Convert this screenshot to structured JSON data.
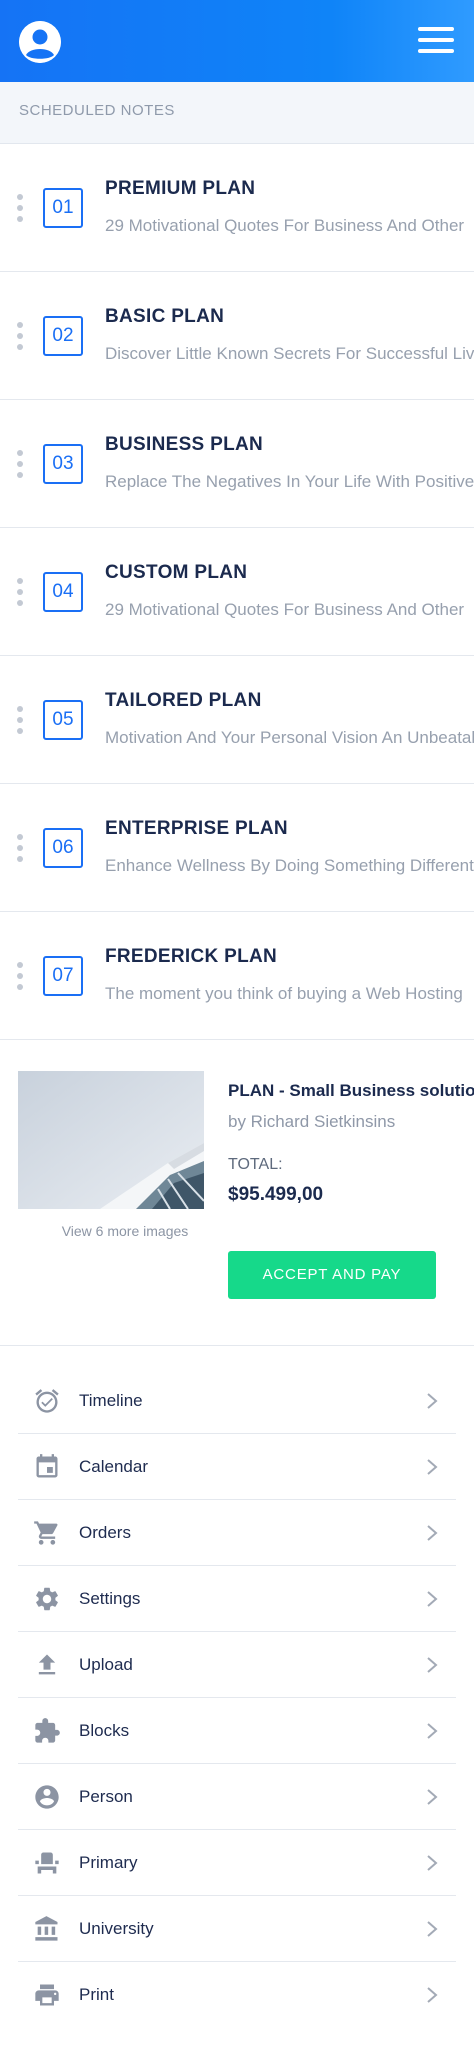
{
  "header": {
    "avatar_icon": "account-circle-icon",
    "menu_icon": "hamburger-menu-icon",
    "colors": {
      "gradient_start": "#1573f5",
      "gradient_end": "#2f9bff"
    }
  },
  "section": {
    "title": "SCHEDULED NOTES"
  },
  "plans": [
    {
      "number": "01",
      "title": "PREMIUM PLAN",
      "description": "29 Motivational Quotes For Business And Other"
    },
    {
      "number": "02",
      "title": "BASIC PLAN",
      "description": "Discover Little Known Secrets For Successful Living"
    },
    {
      "number": "03",
      "title": "BUSINESS PLAN",
      "description": "Replace The Negatives In Your Life With Positives"
    },
    {
      "number": "04",
      "title": "CUSTOM PLAN",
      "description": "29 Motivational Quotes For Business And Other"
    },
    {
      "number": "05",
      "title": "TAILORED PLAN",
      "description": "Motivation And Your Personal Vision An Unbeatable"
    },
    {
      "number": "06",
      "title": "ENTERPRISE PLAN",
      "description": "Enhance Wellness By Doing Something Different"
    },
    {
      "number": "07",
      "title": "FREDERICK PLAN",
      "description": "The moment you think of buying a Web Hosting"
    }
  ],
  "product": {
    "more_images": "View 6 more images",
    "title": "PLAN - Small Business solution",
    "author": "by Richard Sietkinsins",
    "total_label": "TOTAL:",
    "total_value": "$95.499,00",
    "accept_label": "ACCEPT AND PAY",
    "accent_color": "#16d98a"
  },
  "menu": [
    {
      "label": "Timeline",
      "icon": "alarm-clock-icon"
    },
    {
      "label": "Calendar",
      "icon": "calendar-icon"
    },
    {
      "label": "Orders",
      "icon": "shopping-cart-icon"
    },
    {
      "label": "Settings",
      "icon": "gear-icon"
    },
    {
      "label": "Upload",
      "icon": "upload-icon"
    },
    {
      "label": "Blocks",
      "icon": "puzzle-piece-icon"
    },
    {
      "label": "Person",
      "icon": "person-icon"
    },
    {
      "label": "Primary",
      "icon": "seat-icon"
    },
    {
      "label": "University",
      "icon": "bank-icon"
    },
    {
      "label": "Print",
      "icon": "printer-icon"
    }
  ]
}
